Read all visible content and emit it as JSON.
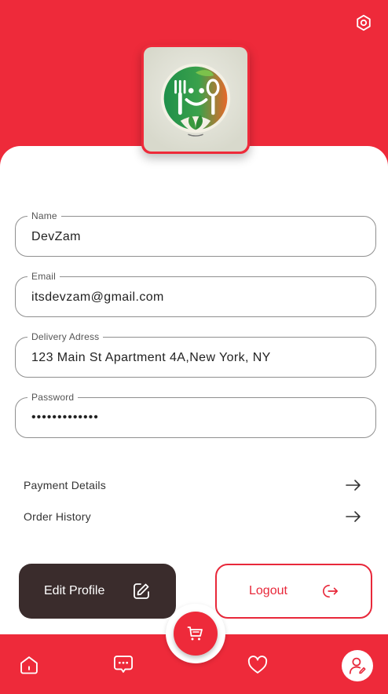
{
  "header": {
    "settings_icon": "settings-hexagon-icon"
  },
  "logo": {
    "icon": "smiley-fork-spoon-leaf-logo"
  },
  "form": {
    "name": {
      "label": "Name",
      "value": "DevZam"
    },
    "email": {
      "label": "Email",
      "value": "itsdevzam@gmail.com"
    },
    "address": {
      "label": "Delivery Adress",
      "value": "123 Main St Apartment 4A,New York, NY"
    },
    "password": {
      "label": "Password",
      "value": "•••••••••••••"
    }
  },
  "menu": {
    "payment": {
      "label": "Payment Details",
      "icon": "arrow-right-icon"
    },
    "history": {
      "label": "Order History",
      "icon": "arrow-right-icon"
    }
  },
  "actions": {
    "edit_profile": {
      "label": "Edit Profile",
      "icon": "edit-icon"
    },
    "logout": {
      "label": "Logout",
      "icon": "logout-icon"
    }
  },
  "nav": {
    "items": [
      "home-icon",
      "chat-icon",
      "cart-icon",
      "heart-icon",
      "profile-icon"
    ],
    "active": "profile-icon"
  },
  "colors": {
    "primary": "#ee2a3a",
    "dark_button": "#3a2c2c",
    "background": "#ffffff"
  }
}
